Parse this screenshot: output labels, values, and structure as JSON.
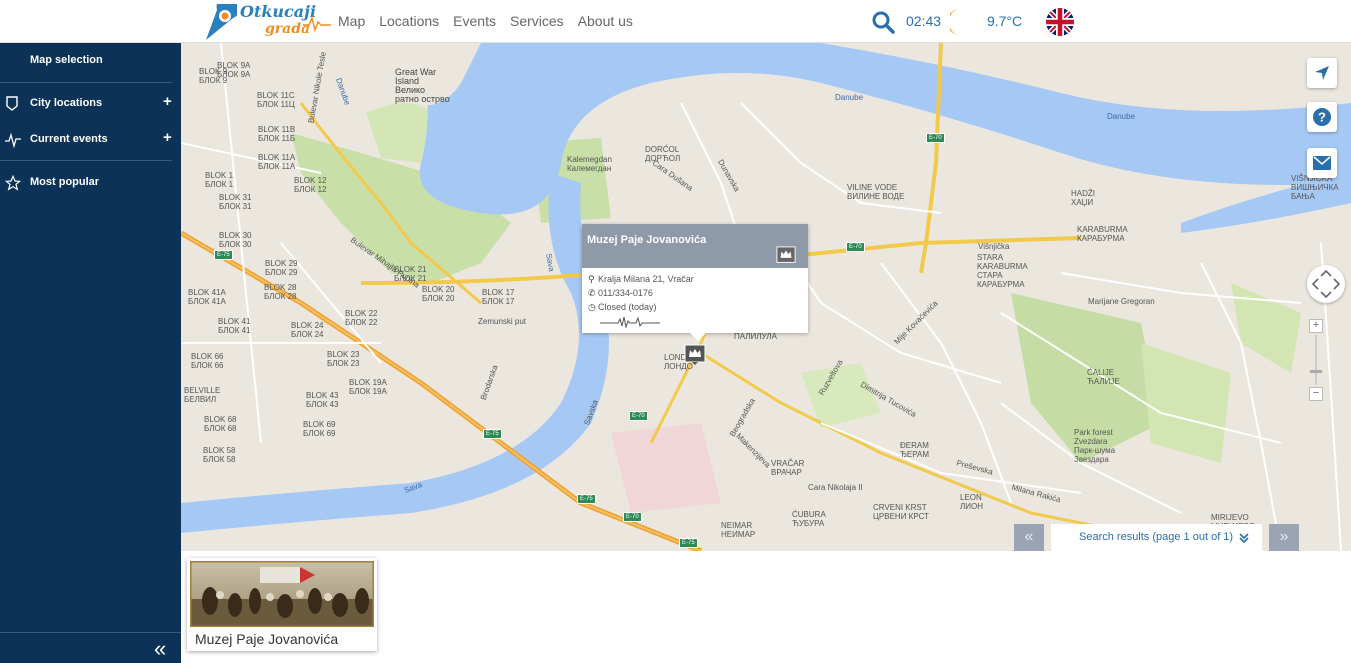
{
  "header": {
    "logo": {
      "line1": "Otkucaji",
      "line2": "grada"
    },
    "nav": [
      "Map",
      "Locations",
      "Events",
      "Services",
      "About us"
    ],
    "time": "02:43",
    "temperature": "9.7°C",
    "language": "English"
  },
  "sidebar": {
    "title": "Map selection",
    "items": [
      {
        "label": "City locations",
        "icon": "map-pin-icon",
        "expandable": true
      },
      {
        "label": "Current events",
        "icon": "pulse-icon",
        "expandable": true
      },
      {
        "label": "Most popular",
        "icon": "star-icon",
        "expandable": false
      }
    ],
    "collapse_icon": "double-chevron-left-icon"
  },
  "map": {
    "labels": {
      "great_war_island": "Great War\nIsland\nВелико\nратно острво",
      "danube_left": "Danube",
      "danube_mid": "Danube",
      "danube_right": "Danube",
      "sava": "Sava",
      "sava2": "Sava",
      "kalemegdan": "Kalemegdan\nКалемегдан",
      "dorcol": "DORĆOL\nДОРЋОЛ",
      "viline_vode": "VILINE VODE\nВИЛИНЕ ВОДЕ",
      "hadzi": "HADŽI\nХАЏИ",
      "karaburma": "KARABURMA\nКАРАБУРМА",
      "stara_karaburma": "STARA\nKARABURMA\nСТАРА\nКАРАБУРМА",
      "visnjicka_banja": "VIŠNJIČKA\nВИШЊИЧКА\nБАЊА",
      "palilula": "ПАЛИЛУЛА",
      "london": "LOND\nЛОНДО",
      "vracar": "VRAČAR\nВРАЧАР",
      "djeram": "ĐERAM\nЂЕРАМ",
      "cubura": "ĆUBURA\nЋУБУРА",
      "crveni_krst": "CRVENI KRST\nЦРВЕНИ КРСТ",
      "leon": "LEON\nЛИОН",
      "neimar": "NEIMAR\nНЕИМАР",
      "caljie": "ĆALIJE\nЋАЛИЈЕ",
      "zvezdara": "Park forest\nZvezdara\nПарк-шума\nЗвездара",
      "mirijevo": "MIRIJEVO\nМИРИЈЕВО",
      "bulevar_nikole_tesle": "Bulevar Nikole Tesle",
      "bulevar_mihajla_pupina": "Bulevar Mihajla Pupina",
      "zemunski_put": "Zemunski put",
      "marijane_gregoran": "Marijane Gregoran",
      "visnjicka": "Višnjička",
      "djure_strugara": "Mije Kovačevića",
      "dimitrija_tucovica": "Dimitrija Tucovića",
      "ruzveltova": "Ruzveltova",
      "makenzijeva": "Makenzijeva",
      "beogradska": "Beogradska",
      "cara_nikolaja": "Cara Nikolaja II",
      "milana_rakica": "Milana Rakića",
      "presevska": "Preševska",
      "cara_dusana": "Cara Dušana",
      "dunavska": "Dunavska",
      "brodarska": "Brodarska",
      "savska": "Savska",
      "blok_labels": [
        "BLOK 9A\nБЛОК 9А",
        "BLOK 9\nБЛОК 9",
        "BLOK 11C\nБЛОК 11Ц",
        "BLOK 11B\nБЛОК 11Б",
        "BLOK 11A\nБЛОК 11А",
        "BLOK 1\nБЛОК 1",
        "BLOK 31\nБЛОК 31",
        "BLOK 30\nБЛОК 30",
        "BLOK 12\nБЛОК 12",
        "BLOK 29\nБЛОК 29",
        "BLOK 28\nБЛОК 28",
        "BLOK 21\nБЛОК 21",
        "BLOK 41A\nБЛОК 41А",
        "BLOK 41\nБЛОК 41",
        "BLOK 22\nБЛОК 22",
        "BLOK 20\nБЛОК 20",
        "BLOK 17\nБЛОК 17",
        "BLOK 24\nБЛОК 24",
        "BLOK 66\nБЛОК 66",
        "BLOK 23\nБЛОК 23",
        "BLOK 19A\nБЛОК 19А",
        "BLOK 43\nБЛОК 43",
        "BLOK 68\nБЛОК 68",
        "BLOK 69\nБЛОК 69",
        "BLOK 58\nБЛОК 58",
        "BELVILLE\nБЕЛВИЛ"
      ],
      "road_e75": "E-75",
      "road_e70": "E-70"
    },
    "controls": {
      "locate": "location-arrow-icon",
      "help": "question-icon",
      "mail": "envelope-icon",
      "zoom_in": "+",
      "zoom_out": "−"
    },
    "popup": {
      "title": "Muzej Paje Jovanovića",
      "address": "Kralja Milana 21, Vračar",
      "phone": "011/334-0176",
      "hours": "Closed (today)"
    },
    "results": {
      "text": "Search results (page 1 out of 1)",
      "prev": "«",
      "next": "»"
    }
  },
  "result_cards": [
    {
      "label": "Muzej Paje Jovanovića"
    }
  ]
}
